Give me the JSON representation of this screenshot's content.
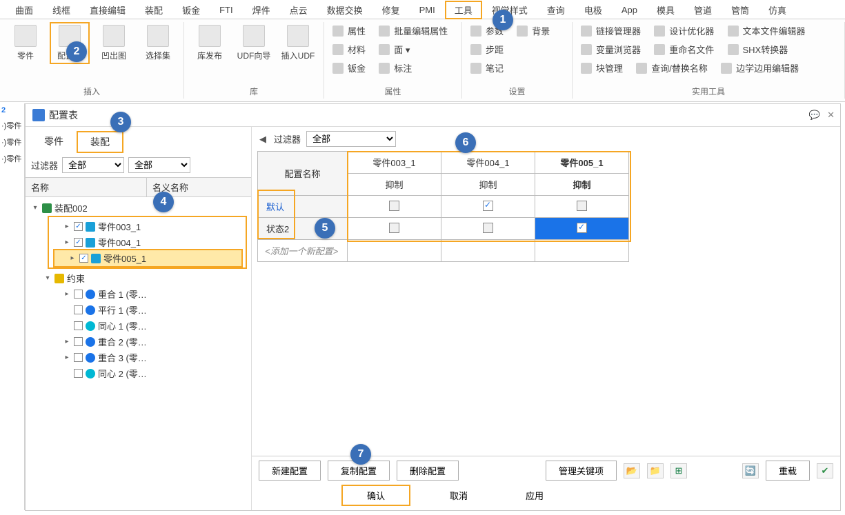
{
  "ribbon_tabs": [
    "曲面",
    "线框",
    "直接编辑",
    "装配",
    "钣金",
    "FTI",
    "焊件",
    "点云",
    "数据交换",
    "修复",
    "PMI",
    "工具",
    "视觉样式",
    "查询",
    "电极",
    "App",
    "模具",
    "管道",
    "管筒",
    "仿真"
  ],
  "ribbon_active_tab": "工具",
  "ribbon": {
    "insert": {
      "label": "插入",
      "items": [
        "零件",
        "配置表",
        "凹出图",
        "选择集"
      ]
    },
    "library": {
      "label": "库",
      "items": [
        "库发布",
        "UDF向导",
        "插入UDF"
      ]
    },
    "attrs": {
      "label": "属性",
      "rows": [
        [
          "属性",
          "批量编辑属性"
        ],
        [
          "材料",
          "面 ▾"
        ],
        [
          "钣金",
          "标注"
        ]
      ]
    },
    "settings": {
      "label": "设置",
      "rows": [
        [
          "参数",
          "背景"
        ],
        [
          "步距",
          ""
        ],
        [
          "笔记",
          ""
        ]
      ]
    },
    "tools1": {
      "rows": [
        [
          "链接管理器",
          "设计优化器",
          "文本文件编辑器"
        ],
        [
          "变量浏览器",
          "重命名文件",
          "SHX转换器"
        ],
        [
          "块管理",
          "查询/替换名称",
          "边学边用编辑器"
        ]
      ],
      "label": "实用工具"
    }
  },
  "panel": {
    "title": "配置表",
    "tabs": [
      "零件",
      "装配"
    ],
    "active_tab": "装配",
    "filter_label": "过滤器",
    "filter_values": [
      "全部",
      "全部"
    ],
    "tree_headers": [
      "名称",
      "名义名称"
    ],
    "tree": {
      "root": "装配002",
      "parts": [
        "零件003_1",
        "零件004_1",
        "零件005_1"
      ],
      "constraints_label": "约束",
      "constraints": [
        "重合 1 (零…",
        "平行 1 (零…",
        "同心 1 (零…",
        "重合 2 (零…",
        "重合 3 (零…",
        "同心 2 (零…"
      ]
    }
  },
  "grid": {
    "filter_label": "过滤器",
    "filter_value": "全部",
    "config_name_header": "配置名称",
    "col_headers": [
      "零件003_1",
      "零件004_1",
      "零件005_1"
    ],
    "sub_header": "抑制",
    "rows": [
      "默认",
      "状态2"
    ],
    "placeholder": "<添加一个新配置>",
    "checks": [
      [
        false,
        true,
        false
      ],
      [
        false,
        false,
        true
      ]
    ]
  },
  "buttons": {
    "new_config": "新建配置",
    "copy_config": "复制配置",
    "delete_config": "删除配置",
    "manage_keys": "管理关键项",
    "reload": "重载",
    "ok": "确认",
    "cancel": "取消",
    "apply": "应用"
  },
  "left_sliver": [
    "2",
    "·)零件",
    "·)零件",
    "·)零件"
  ],
  "steps": {
    "1": "1",
    "2": "2",
    "3": "3",
    "4": "4",
    "5": "5",
    "6": "6",
    "7": "7"
  }
}
